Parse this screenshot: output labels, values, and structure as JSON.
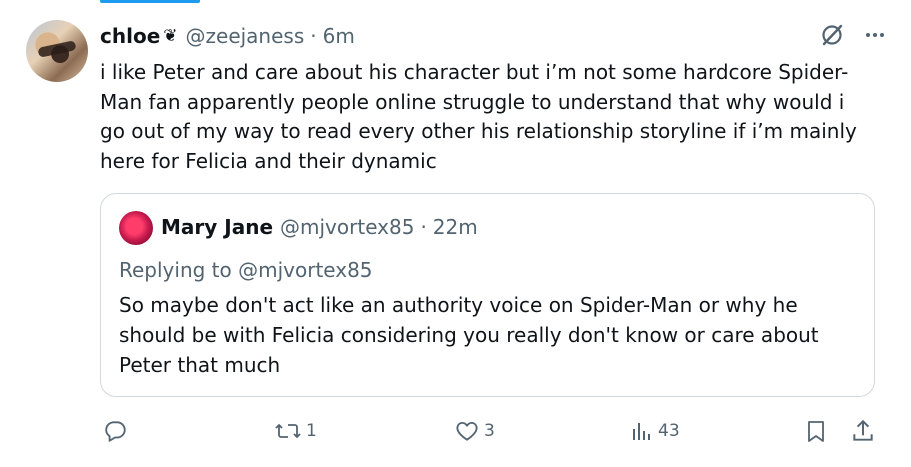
{
  "tweet": {
    "display_name": "chloe",
    "badge": "❦",
    "handle": "@zeejaness",
    "separator": "·",
    "time": "6m",
    "text": "i like Peter and care about his character but i’m not some hardcore Spider-Man fan apparently people online struggle to understand that why would i go out of my way to read every other his relationship storyline if i’m mainly here for Felicia and their dynamic"
  },
  "quoted": {
    "display_name": "Mary Jane",
    "handle": "@mjvortex85",
    "separator": "·",
    "time": "22m",
    "replying_to": "Replying to @mjvortex85",
    "text": "So maybe don't act like an authority voice on Spider-Man or why he should be with Felicia considering you really don't know or care about Peter that much"
  },
  "actions": {
    "reply_count": "",
    "retweet_count": "1",
    "like_count": "3",
    "views_count": "43"
  },
  "icons": {
    "grok": "grok-icon",
    "more": "more-icon",
    "reply": "reply-icon",
    "retweet": "retweet-icon",
    "like": "heart-icon",
    "views": "views-icon",
    "bookmark": "bookmark-icon",
    "share": "share-icon"
  },
  "colors": {
    "accent": "#1d9bf0",
    "secondary_text": "#536471",
    "border": "#cfd9de"
  }
}
